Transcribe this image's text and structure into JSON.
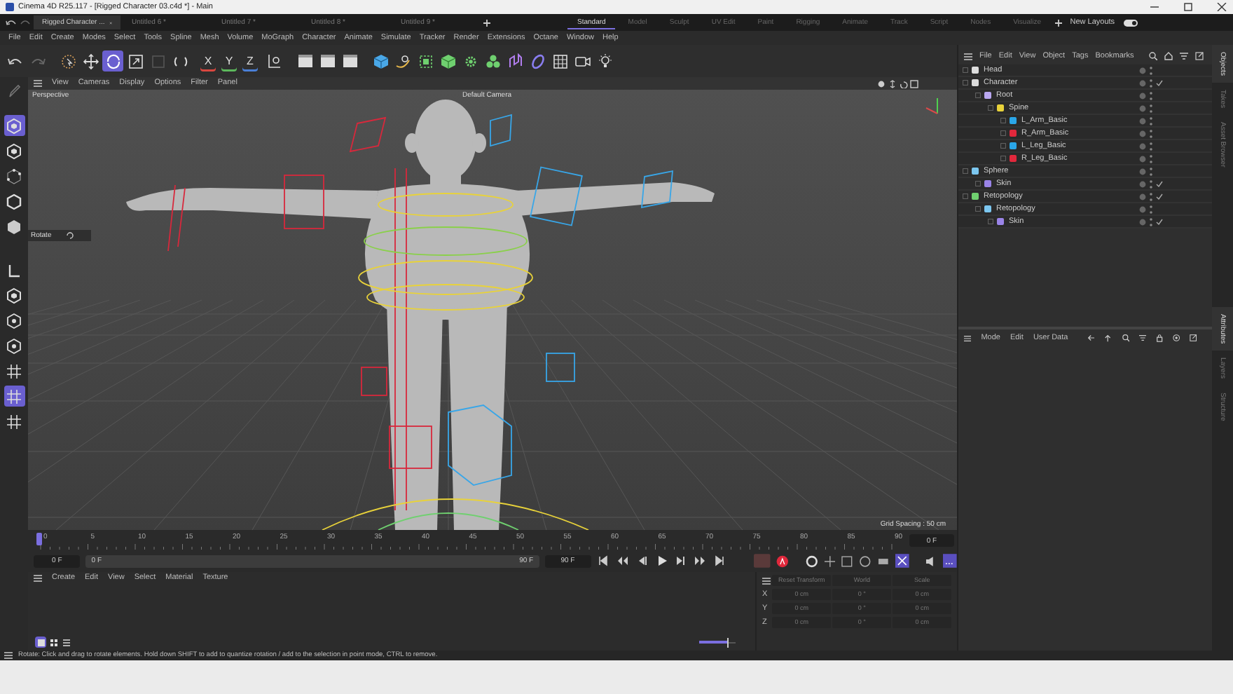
{
  "window": {
    "title": "Cinema 4D R25.117 - [Rigged Character 03.c4d *] - Main"
  },
  "doc_tabs": [
    {
      "label": "Rigged Character ...",
      "selected": true
    },
    {
      "label": "Untitled 6 *",
      "selected": false
    },
    {
      "label": "Untitled 7 *",
      "selected": false
    },
    {
      "label": "Untitled 8 *",
      "selected": false
    },
    {
      "label": "Untitled 9 *",
      "selected": false
    }
  ],
  "layouts": [
    {
      "label": "Standard",
      "selected": true
    },
    {
      "label": "Model",
      "selected": false
    },
    {
      "label": "Sculpt",
      "selected": false
    },
    {
      "label": "UV Edit",
      "selected": false
    },
    {
      "label": "Paint",
      "selected": false
    },
    {
      "label": "Rigging",
      "selected": false
    },
    {
      "label": "Animate",
      "selected": false
    },
    {
      "label": "Track",
      "selected": false
    },
    {
      "label": "Script",
      "selected": false
    },
    {
      "label": "Nodes",
      "selected": false
    },
    {
      "label": "Visualize",
      "selected": false
    }
  ],
  "new_layouts": {
    "label": "New Layouts",
    "on": true
  },
  "menu": [
    "File",
    "Edit",
    "Create",
    "Modes",
    "Select",
    "Tools",
    "Spline",
    "Mesh",
    "Volume",
    "MoGraph",
    "Character",
    "Animate",
    "Simulate",
    "Tracker",
    "Render",
    "Extensions",
    "Octane",
    "Window",
    "Help"
  ],
  "toolbar": [
    {
      "kind": "undo",
      "selected": false
    },
    {
      "kind": "redo",
      "selected": false
    },
    {
      "kind": "select",
      "selected": false
    },
    {
      "kind": "move",
      "selected": false
    },
    {
      "kind": "rotate",
      "selected": true
    },
    {
      "kind": "scale",
      "selected": false
    },
    {
      "kind": "square",
      "selected": false
    },
    {
      "kind": "arrows",
      "selected": false
    },
    {
      "kind": "axis",
      "label": "X",
      "color": "#d9473f",
      "selected": false
    },
    {
      "kind": "axis",
      "label": "Y",
      "color": "#5cb85c",
      "selected": false
    },
    {
      "kind": "axis",
      "label": "Z",
      "color": "#4a7fd6",
      "selected": false
    },
    {
      "kind": "coords",
      "selected": false
    },
    {
      "kind": "clapper",
      "selected": false
    },
    {
      "kind": "clapper",
      "selected": false
    },
    {
      "kind": "clapper",
      "selected": false
    },
    {
      "kind": "cube",
      "selected": false
    },
    {
      "kind": "curve",
      "selected": false
    },
    {
      "kind": "frame",
      "selected": false
    },
    {
      "kind": "greencube",
      "selected": false
    },
    {
      "kind": "gear",
      "selected": false
    },
    {
      "kind": "cluster",
      "selected": false
    },
    {
      "kind": "deformer",
      "selected": false
    },
    {
      "kind": "ring",
      "selected": false
    },
    {
      "kind": "grid",
      "selected": false
    },
    {
      "kind": "camera",
      "selected": false
    },
    {
      "kind": "light",
      "selected": false
    }
  ],
  "mode_tools": [
    {
      "kind": "pencil",
      "selected": false
    },
    {
      "kind": "hexagon",
      "selected": true
    },
    {
      "kind": "hexagon",
      "selected": false
    },
    {
      "kind": "points",
      "selected": false
    },
    {
      "kind": "edges",
      "selected": false
    },
    {
      "kind": "polygons",
      "selected": false
    },
    {
      "kind": "corner",
      "selected": false
    },
    {
      "kind": "hexagon",
      "selected": false
    },
    {
      "kind": "target",
      "selected": false
    },
    {
      "kind": "target",
      "selected": false
    },
    {
      "kind": "grid",
      "selected": false
    },
    {
      "kind": "grid",
      "selected": true
    },
    {
      "kind": "grid",
      "selected": false
    }
  ],
  "viewport": {
    "menu": [
      "View",
      "Cameras",
      "Display",
      "Options",
      "Filter",
      "Panel"
    ],
    "view_name": "Perspective",
    "camera": "Default Camera",
    "tool_panel": "Rotate",
    "grid_spacing": "Grid Spacing : 50 cm"
  },
  "object_manager": {
    "menu": [
      "File",
      "Edit",
      "View",
      "Object",
      "Tags",
      "Bookmarks"
    ],
    "objects": [
      {
        "name": "Head",
        "color": "#dddddd",
        "checked": false
      },
      {
        "name": "Character",
        "color": "#dddddd",
        "checked": true,
        "children": [
          {
            "name": "Root",
            "color": "#b9a7f0",
            "checked": false,
            "children": [
              {
                "name": "Spine",
                "color": "#e8d23a",
                "checked": false,
                "children": [
                  {
                    "name": "L_Arm_Basic",
                    "color": "#2aa6e8",
                    "checked": false
                  },
                  {
                    "name": "R_Arm_Basic",
                    "color": "#e2283c",
                    "checked": false
                  },
                  {
                    "name": "L_Leg_Basic",
                    "color": "#2aa6e8",
                    "checked": false
                  },
                  {
                    "name": "R_Leg_Basic",
                    "color": "#e2283c",
                    "checked": false
                  }
                ]
              }
            ]
          }
        ]
      },
      {
        "name": "Sphere",
        "color": "#7cc7f0",
        "checked": false,
        "children": [
          {
            "name": "Skin",
            "color": "#9a84e8",
            "checked": true
          }
        ]
      },
      {
        "name": "Retopology",
        "color": "#6fd06f",
        "checked": true,
        "children": [
          {
            "name": "Retopology",
            "color": "#7cc7f0",
            "checked": false,
            "children": [
              {
                "name": "Skin",
                "color": "#9a84e8",
                "checked": true
              }
            ]
          }
        ]
      }
    ]
  },
  "side_tabs_top": [
    {
      "label": "Objects",
      "selected": true
    },
    {
      "label": "Takes",
      "selected": false
    },
    {
      "label": "Asset Browser",
      "selected": false
    }
  ],
  "attribute_manager": {
    "menu": [
      "Mode",
      "Edit",
      "User Data"
    ]
  },
  "side_tabs_bottom": [
    {
      "label": "Attributes",
      "selected": true
    },
    {
      "label": "Layers",
      "selected": false
    },
    {
      "label": "Structure",
      "selected": false
    }
  ],
  "timeline": {
    "ticks": [
      "0",
      "5",
      "10",
      "15",
      "20",
      "25",
      "30",
      "35",
      "40",
      "45",
      "50",
      "55",
      "60",
      "65",
      "70",
      "75",
      "80",
      "85",
      "90"
    ],
    "current_frame": "0 F",
    "start_frame": "0 F",
    "range_start": "0 F",
    "range_end": "90 F",
    "end_frame": "90 F"
  },
  "material_manager": {
    "menu": [
      "Create",
      "Edit",
      "View",
      "Select",
      "Material",
      "Texture"
    ],
    "views": [
      {
        "selected": true
      },
      {
        "selected": false
      },
      {
        "selected": false
      }
    ],
    "zoom_slider": {
      "level": 0.75
    }
  },
  "coordinates": {
    "reset": "Reset Transform",
    "space": "World",
    "mode": "Scale",
    "rows": [
      {
        "axis": "X",
        "values": [
          "0 cm",
          "0 °",
          "0 cm"
        ]
      },
      {
        "axis": "Y",
        "values": [
          "0 cm",
          "0 °",
          "0 cm"
        ]
      },
      {
        "axis": "Z",
        "values": [
          "0 cm",
          "0 °",
          "0 cm"
        ]
      }
    ]
  },
  "status_bar": "Rotate: Click and drag to rotate elements. Hold down SHIFT to add to quantize rotation / add to the selection in point mode, CTRL to remove."
}
